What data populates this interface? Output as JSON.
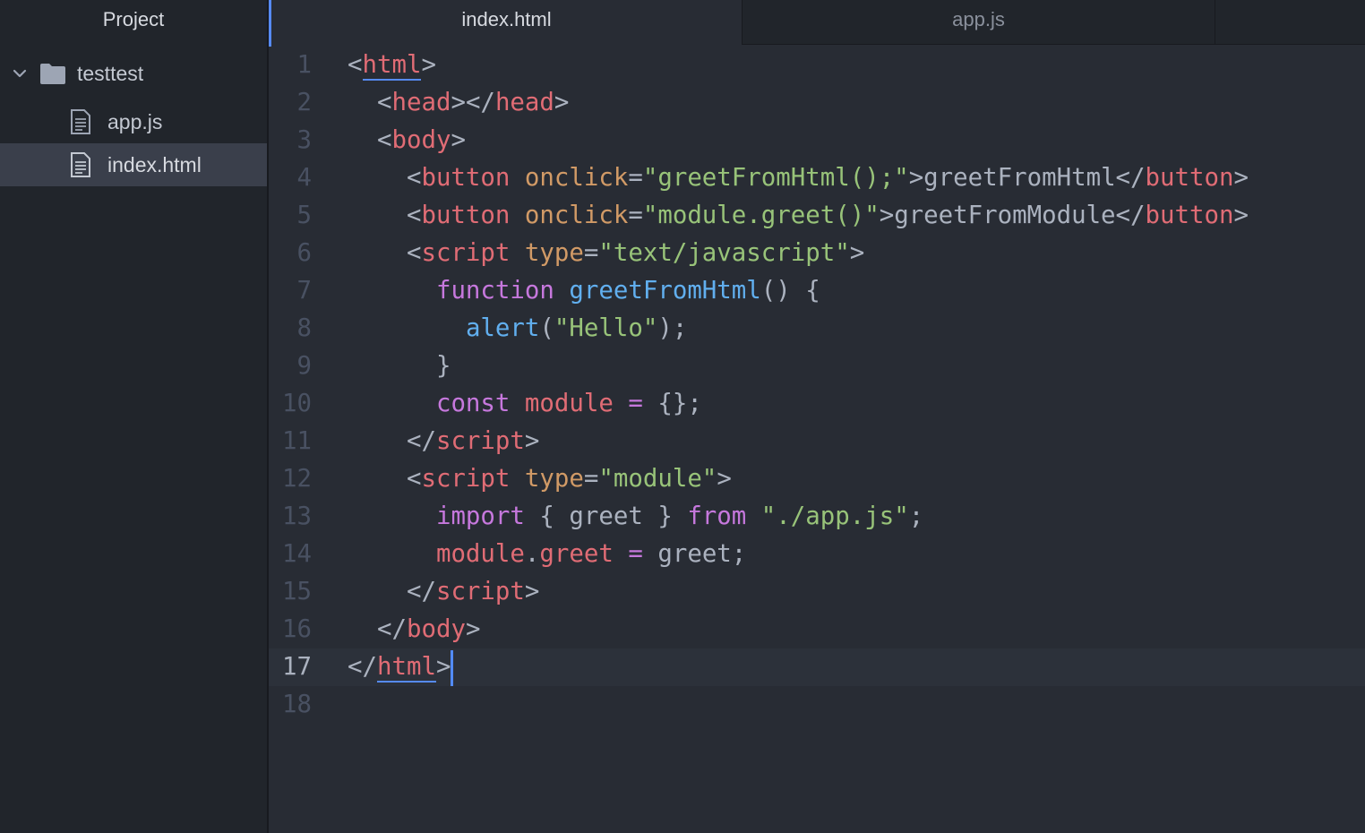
{
  "sidebar": {
    "title": "Project",
    "folder": {
      "name": "testtest",
      "expanded": true
    },
    "files": [
      {
        "name": "app.js",
        "selected": false
      },
      {
        "name": "index.html",
        "selected": true
      }
    ]
  },
  "tabs": [
    {
      "label": "index.html",
      "active": true
    },
    {
      "label": "app.js",
      "active": false
    }
  ],
  "editor": {
    "cursor_line": 17,
    "lines": [
      {
        "number": "1",
        "tokens": [
          [
            "p",
            "<"
          ],
          [
            "tg",
            "html",
            "ul"
          ],
          [
            "p",
            ">"
          ]
        ]
      },
      {
        "number": "2",
        "tokens": [
          [
            "p",
            "  <"
          ],
          [
            "tg",
            "head"
          ],
          [
            "p",
            "></"
          ],
          [
            "tg",
            "head"
          ],
          [
            "p",
            ">"
          ]
        ]
      },
      {
        "number": "3",
        "tokens": [
          [
            "p",
            "  <"
          ],
          [
            "tg",
            "body"
          ],
          [
            "p",
            ">"
          ]
        ]
      },
      {
        "number": "4",
        "tokens": [
          [
            "p",
            "    <"
          ],
          [
            "tg",
            "button"
          ],
          [
            "p",
            " "
          ],
          [
            "at",
            "onclick"
          ],
          [
            "p",
            "="
          ],
          [
            "st",
            "\"greetFromHtml();\""
          ],
          [
            "p",
            ">greetFromHtml</"
          ],
          [
            "tg",
            "button"
          ],
          [
            "p",
            ">"
          ]
        ]
      },
      {
        "number": "5",
        "tokens": [
          [
            "p",
            "    <"
          ],
          [
            "tg",
            "button"
          ],
          [
            "p",
            " "
          ],
          [
            "at",
            "onclick"
          ],
          [
            "p",
            "="
          ],
          [
            "st",
            "\"module.greet()\""
          ],
          [
            "p",
            ">greetFromModule</"
          ],
          [
            "tg",
            "button"
          ],
          [
            "p",
            ">"
          ]
        ]
      },
      {
        "number": "6",
        "tokens": [
          [
            "p",
            "    <"
          ],
          [
            "tg",
            "script"
          ],
          [
            "p",
            " "
          ],
          [
            "at",
            "type"
          ],
          [
            "p",
            "="
          ],
          [
            "st",
            "\"text/javascript\""
          ],
          [
            "p",
            ">"
          ]
        ]
      },
      {
        "number": "7",
        "tokens": [
          [
            "p",
            "      "
          ],
          [
            "kw",
            "function"
          ],
          [
            "p",
            " "
          ],
          [
            "fn",
            "greetFromHtml"
          ],
          [
            "p",
            "() {"
          ]
        ]
      },
      {
        "number": "8",
        "tokens": [
          [
            "p",
            "        "
          ],
          [
            "fn",
            "alert"
          ],
          [
            "p",
            "("
          ],
          [
            "st",
            "\"Hello\""
          ],
          [
            "p",
            ");"
          ]
        ]
      },
      {
        "number": "9",
        "tokens": [
          [
            "p",
            "      }"
          ]
        ]
      },
      {
        "number": "10",
        "tokens": [
          [
            "p",
            "      "
          ],
          [
            "kw",
            "const"
          ],
          [
            "p",
            " "
          ],
          [
            "vr",
            "module"
          ],
          [
            "p",
            " "
          ],
          [
            "op",
            "="
          ],
          [
            "p",
            " {};"
          ]
        ]
      },
      {
        "number": "11",
        "tokens": [
          [
            "p",
            "    </"
          ],
          [
            "tg",
            "script"
          ],
          [
            "p",
            ">"
          ]
        ]
      },
      {
        "number": "12",
        "tokens": [
          [
            "p",
            "    <"
          ],
          [
            "tg",
            "script"
          ],
          [
            "p",
            " "
          ],
          [
            "at",
            "type"
          ],
          [
            "p",
            "="
          ],
          [
            "st",
            "\"module\""
          ],
          [
            "p",
            ">"
          ]
        ]
      },
      {
        "number": "13",
        "tokens": [
          [
            "p",
            "      "
          ],
          [
            "kw",
            "import"
          ],
          [
            "p",
            " { greet } "
          ],
          [
            "kw",
            "from"
          ],
          [
            "p",
            " "
          ],
          [
            "st",
            "\"./app.js\""
          ],
          [
            "p",
            ";"
          ]
        ]
      },
      {
        "number": "14",
        "tokens": [
          [
            "p",
            "      "
          ],
          [
            "vr",
            "module"
          ],
          [
            "p",
            "."
          ],
          [
            "vr",
            "greet"
          ],
          [
            "p",
            " "
          ],
          [
            "op",
            "="
          ],
          [
            "p",
            " greet;"
          ]
        ]
      },
      {
        "number": "15",
        "tokens": [
          [
            "p",
            "    </"
          ],
          [
            "tg",
            "script"
          ],
          [
            "p",
            ">"
          ]
        ]
      },
      {
        "number": "16",
        "tokens": [
          [
            "p",
            "  </"
          ],
          [
            "tg",
            "body"
          ],
          [
            "p",
            ">"
          ]
        ]
      },
      {
        "number": "17",
        "tokens": [
          [
            "p",
            "</"
          ],
          [
            "tg",
            "html",
            "ul"
          ],
          [
            "p",
            ">"
          ]
        ]
      },
      {
        "number": "18",
        "tokens": []
      }
    ]
  }
}
